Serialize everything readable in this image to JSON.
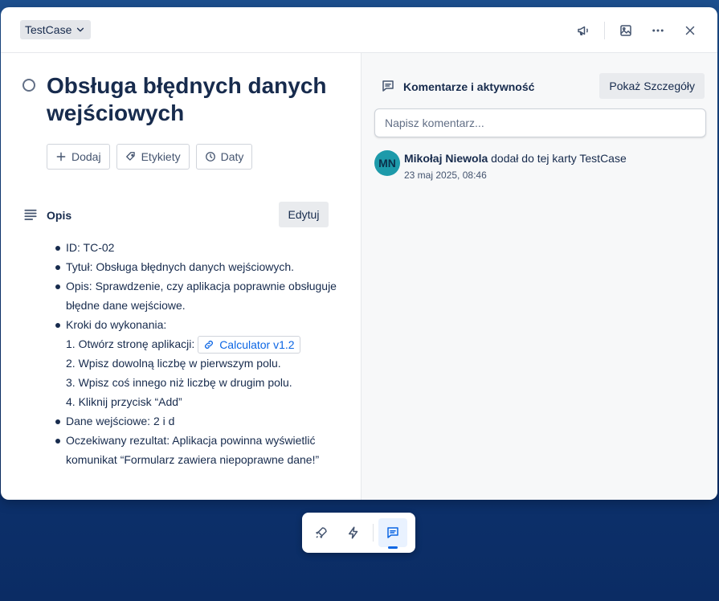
{
  "header": {
    "list_name": "TestCase"
  },
  "card": {
    "title": "Obsługa błędnych danych wejściowych",
    "actions": {
      "add": "Dodaj",
      "labels": "Etykiety",
      "dates": "Daty"
    }
  },
  "description": {
    "heading": "Opis",
    "edit_label": "Edytuj",
    "id": "ID: TC-02",
    "title_line": "Tytuł: Obsługa błędnych danych wejściowych.",
    "desc_line": "Opis: Sprawdzenie, czy aplikacja poprawnie obsługuje błędne dane wejściowe.",
    "steps_heading": "Kroki do wykonania:",
    "step1_text": "1. Otwórz stronę aplikacji:",
    "step1_link": "Calculator v1.2",
    "step2": "2. Wpisz dowolną liczbę w pierwszym polu.",
    "step3": "3. Wpisz coś innego niż liczbę w drugim polu.",
    "step4": "4. Kliknij przycisk “Add”",
    "input_data": "Dane wejściowe: 2 i d",
    "expected": "Oczekiwany rezultat: Aplikacja powinna wyświetlić komunikat “Formularz zawiera niepoprawne dane!”"
  },
  "sidebar": {
    "heading": "Komentarze i aktywność",
    "details_button": "Pokaż Szczegóły",
    "comment_placeholder": "Napisz komentarz...",
    "activity": {
      "avatar_initials": "MN",
      "user": "Mikołaj Niewola",
      "action": " dodał do tej karty TestCase",
      "time": "23 maj 2025, 08:46"
    }
  },
  "colors": {
    "accent": "#0c66e4",
    "avatar": "#1d9aaa"
  }
}
